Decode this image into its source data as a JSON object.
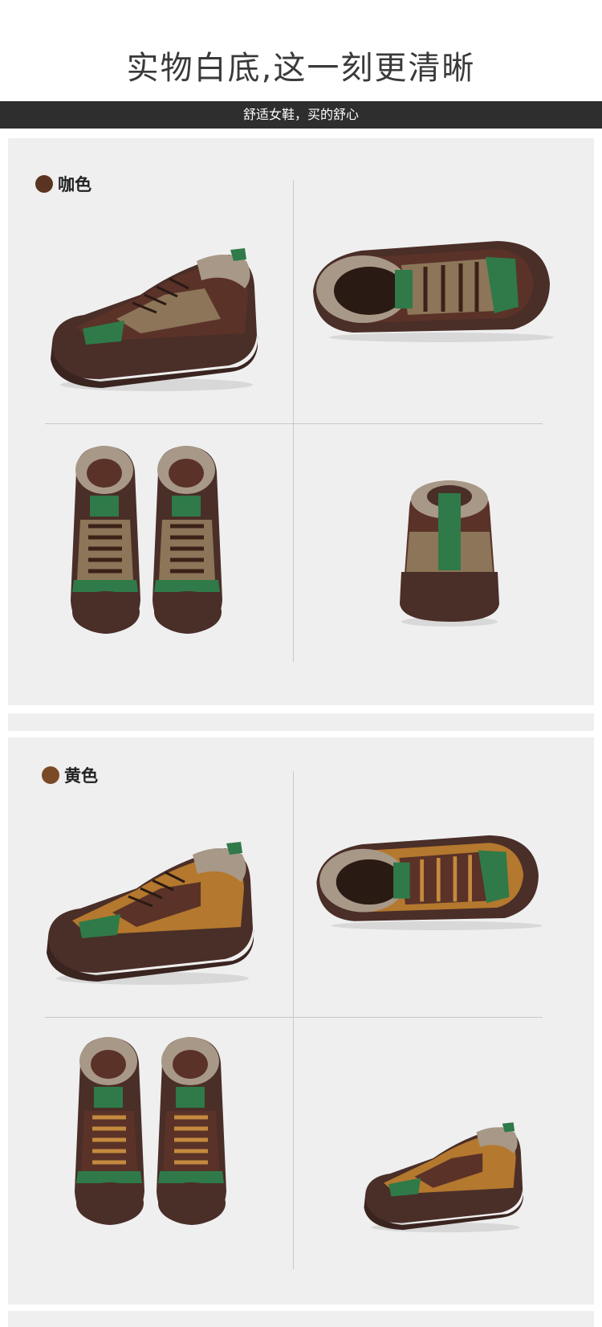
{
  "header": {
    "title": "实物白底,这一刻更清晰",
    "subtitle": "舒适女鞋，买的舒心"
  },
  "colors": {
    "coffee_dot": "#5a3420",
    "yellow_dot": "#7a4a26",
    "panel_bg": "#efefef",
    "bar_bg": "#2e2e2e",
    "sole": "#4a2e28",
    "suede_dark": "#5a3228",
    "suede_tan": "#8c7558",
    "suede_yellow": "#b4782e",
    "accent_green": "#2f7a48",
    "fur": "#a89888"
  },
  "sections": [
    {
      "label": "咖色",
      "views": [
        "side-view",
        "top-side-view",
        "front-pair-view",
        "back-view"
      ]
    },
    {
      "label": "黄色",
      "views": [
        "side-view",
        "top-side-view",
        "front-pair-view",
        "side-view-right"
      ]
    }
  ]
}
